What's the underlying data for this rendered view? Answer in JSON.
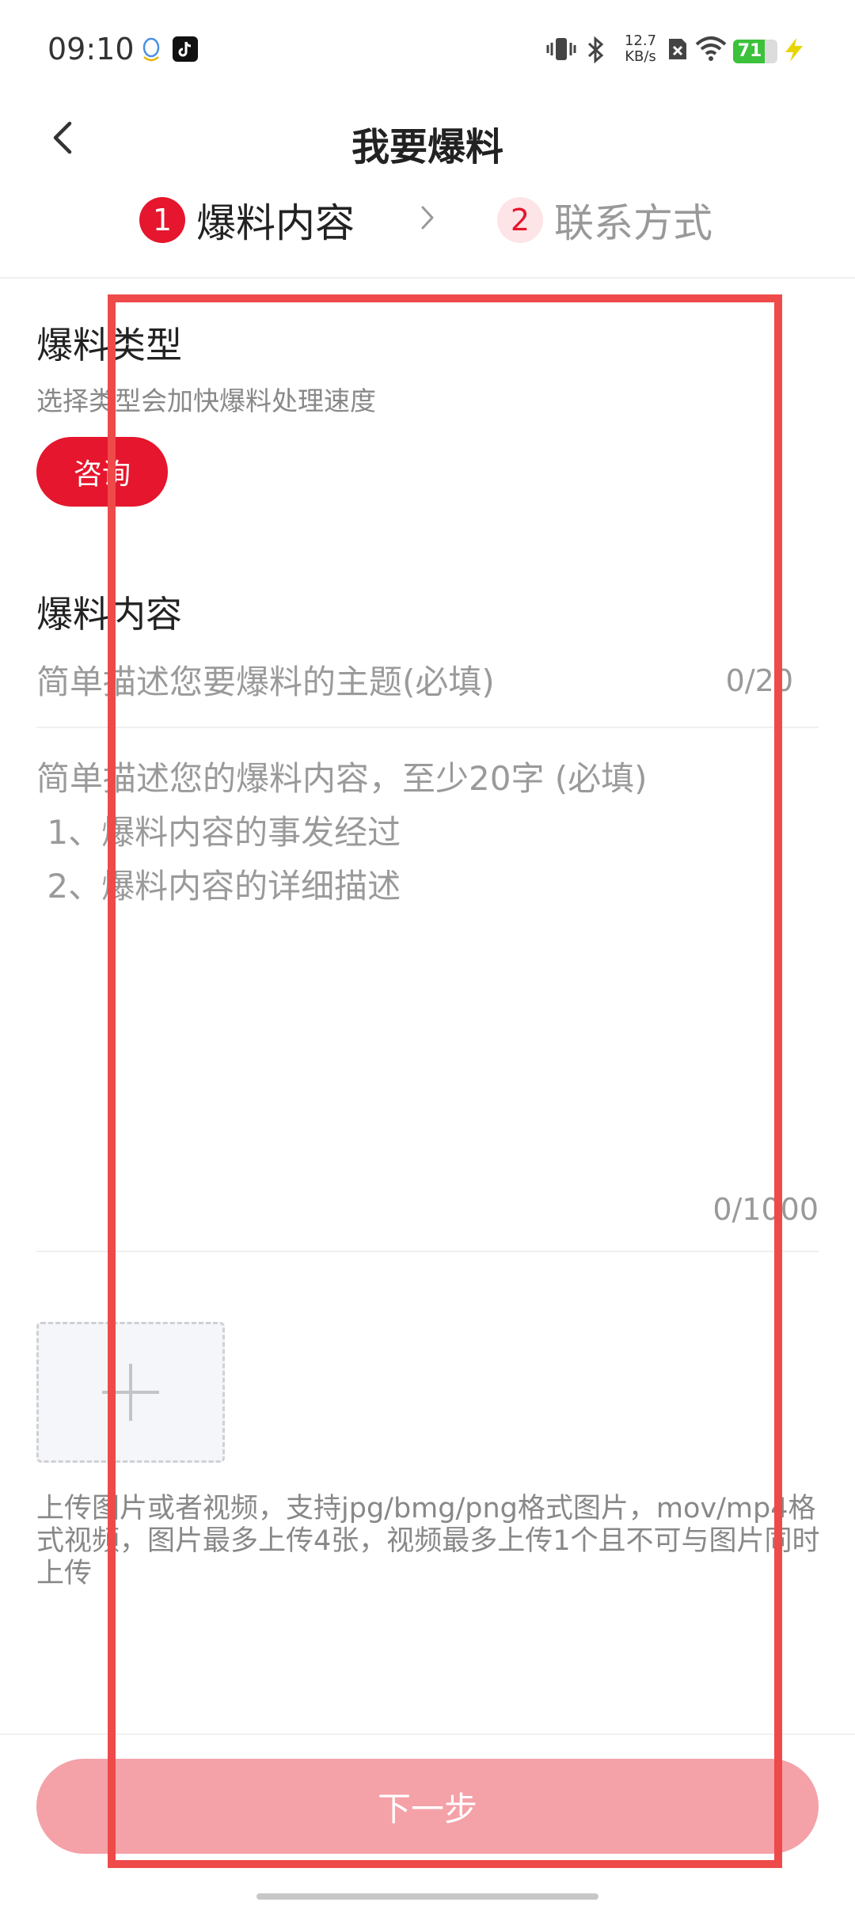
{
  "status_bar": {
    "time": "09:10",
    "net_speed_value": "12.7",
    "net_speed_unit": "KB/s",
    "battery_level": "71",
    "icons": [
      "qq-icon",
      "tiktok-icon",
      "vibrate-icon",
      "bluetooth-icon",
      "sim-x-icon",
      "wifi-icon",
      "battery-icon",
      "charging-icon"
    ]
  },
  "header": {
    "title": "我要爆料"
  },
  "steps": [
    {
      "number": "1",
      "label": "爆料内容"
    },
    {
      "number": "2",
      "label": "联系方式"
    }
  ],
  "type_section": {
    "title": "爆料类型",
    "subtitle": "选择类型会加快爆料处理速度",
    "selected_type": "咨询"
  },
  "content_section": {
    "title": "爆料内容",
    "subject_placeholder": "简单描述您要爆料的主题(必填)",
    "subject_count": "0/20",
    "body_placeholder": "简单描述您的爆料内容，至少20字 (必填)\n 1、爆料内容的事发经过\n 2、爆料内容的详细描述",
    "body_count": "0/1000"
  },
  "upload": {
    "hint": "上传图片或者视频，支持jpg/bmg/png格式图片，mov/mp4格式视频，图片最多上传4张，视频最多上传1个且不可与图片同时上传"
  },
  "footer": {
    "next_label": "下一步"
  },
  "colors": {
    "accent": "#e5162d",
    "accent_light": "#fde4e6",
    "button_disabled": "#f4a1a8",
    "highlight": "#ee4a4a"
  }
}
